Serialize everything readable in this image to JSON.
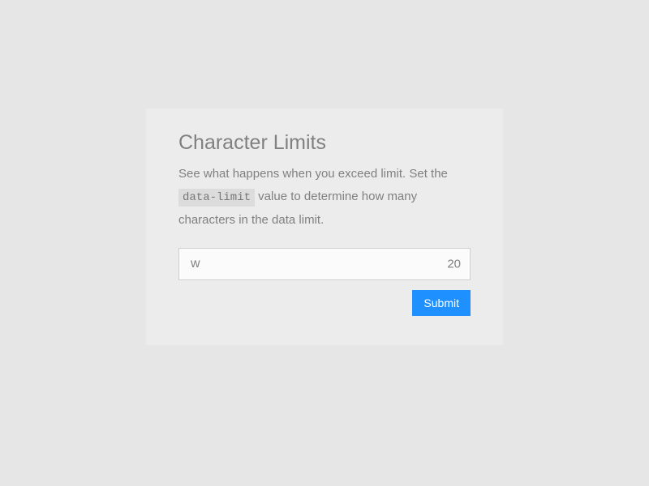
{
  "card": {
    "title": "Character Limits",
    "description_pre": "See what happens when you exceed limit. Set the ",
    "code_text": "data-limit",
    "description_post": " value to determine how many characters in the data limit."
  },
  "input": {
    "value": "w",
    "counter": "20"
  },
  "submit_label": "Submit"
}
